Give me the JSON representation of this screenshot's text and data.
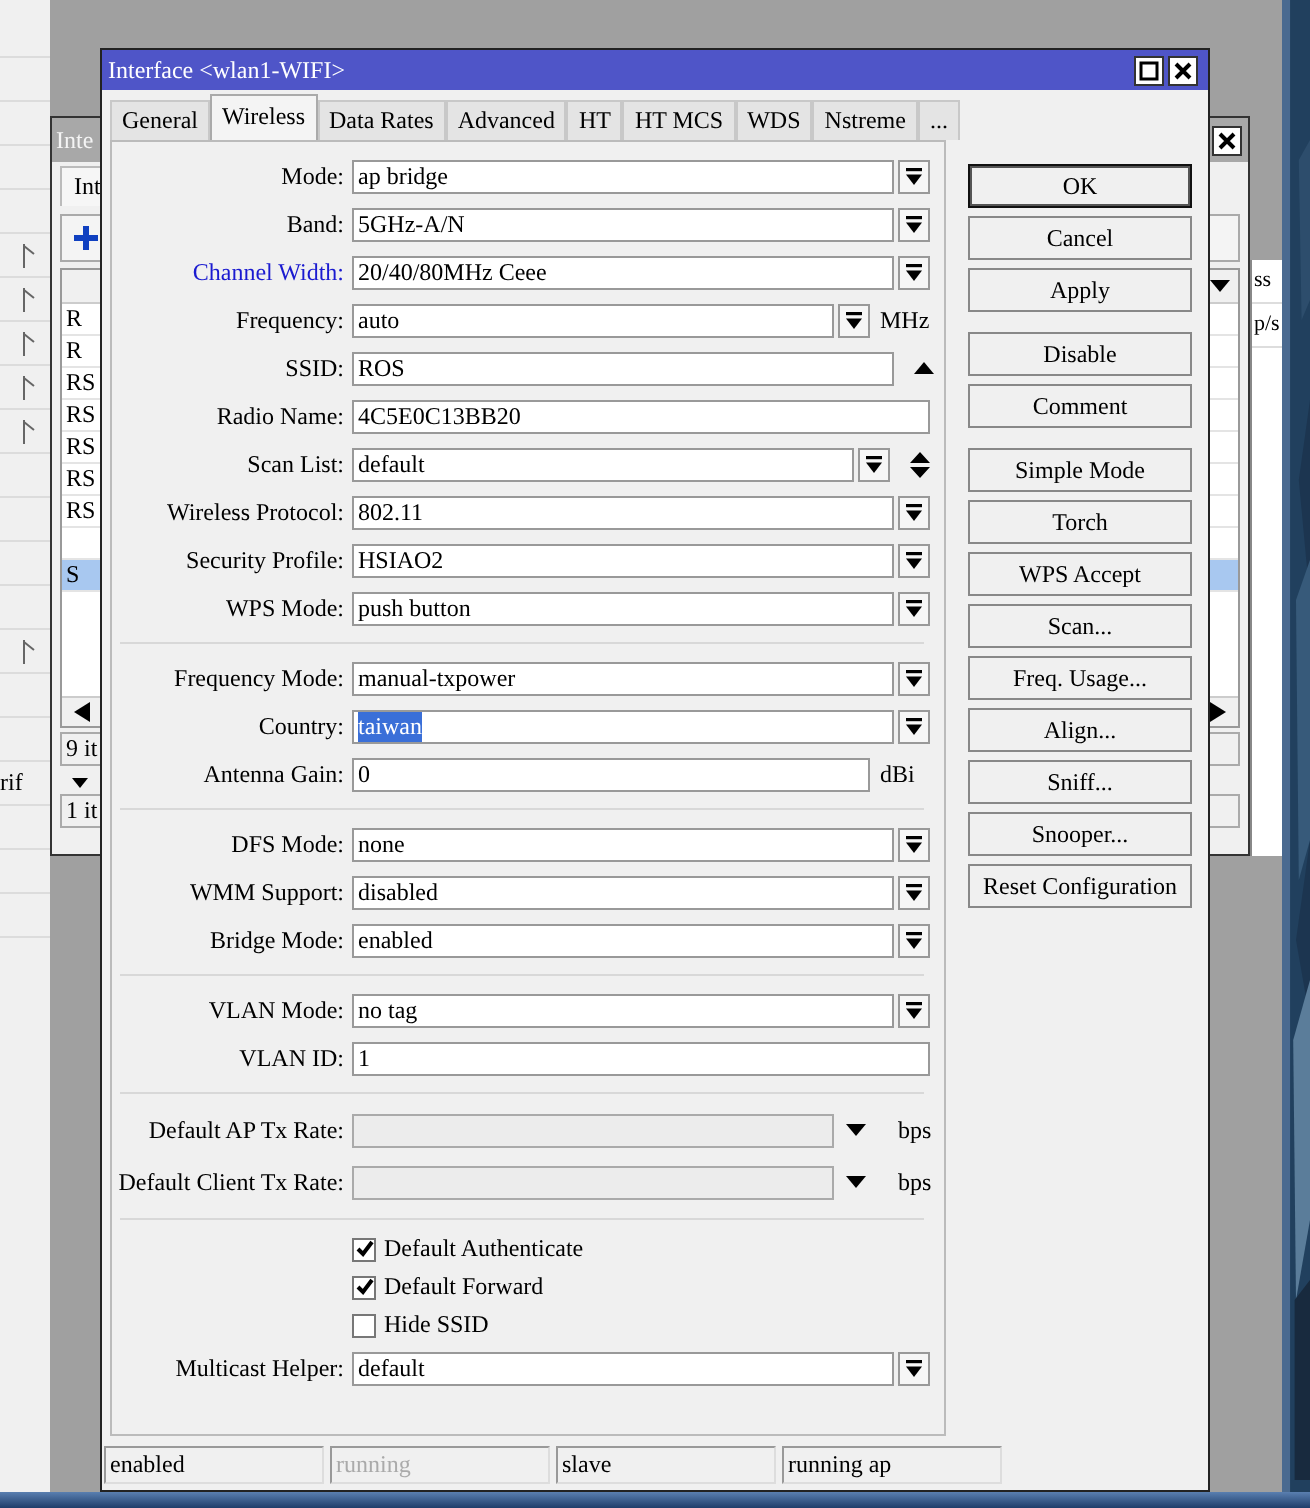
{
  "side_list": {
    "rows": [
      {
        "flagged": false
      },
      {
        "flagged": false
      },
      {
        "flagged": false
      },
      {
        "flagged": false
      },
      {
        "flagged": false
      },
      {
        "flagged": true
      },
      {
        "flagged": true
      },
      {
        "flagged": true
      },
      {
        "flagged": true
      },
      {
        "flagged": true
      },
      {
        "flagged": false
      },
      {
        "flagged": false
      },
      {
        "flagged": false
      },
      {
        "flagged": false
      },
      {
        "flagged": true
      },
      {
        "flagged": false
      },
      {
        "flagged": false
      },
      {
        "flagged": false,
        "text": "rif"
      },
      {
        "flagged": false
      },
      {
        "flagged": false
      },
      {
        "flagged": false
      }
    ]
  },
  "back_window": {
    "title": "Inte",
    "tab": "Int",
    "rows": [
      {
        "flag": "R",
        "selected": false
      },
      {
        "flag": "R",
        "selected": false
      },
      {
        "flag": "RS",
        "selected": false
      },
      {
        "flag": "RS",
        "selected": false
      },
      {
        "flag": "RS",
        "selected": false
      },
      {
        "flag": "RS",
        "selected": false
      },
      {
        "flag": "RS",
        "selected": false
      },
      {
        "selected": false
      },
      {
        "flag": "S",
        "selected": true
      }
    ],
    "counts": [
      "9 it",
      "1 it"
    ]
  },
  "third_window": {
    "headers": [
      "ss",
      "p/s"
    ]
  },
  "dialog": {
    "title": "Interface <wlan1-WIFI>",
    "tabs": [
      {
        "label": "General",
        "selected": false
      },
      {
        "label": "Wireless",
        "selected": true
      },
      {
        "label": "Data Rates",
        "selected": false
      },
      {
        "label": "Advanced",
        "selected": false
      },
      {
        "label": "HT",
        "selected": false
      },
      {
        "label": "HT MCS",
        "selected": false
      },
      {
        "label": "WDS",
        "selected": false
      },
      {
        "label": "Nstreme",
        "selected": false
      },
      {
        "label": "...",
        "selected": false
      }
    ],
    "sections": [
      {
        "fields": [
          {
            "kind": "dropdown",
            "label": "Mode:",
            "value": "ap bridge"
          },
          {
            "kind": "dropdown",
            "label": "Band:",
            "value": "5GHz-A/N"
          },
          {
            "kind": "dropdown",
            "label": "Channel Width:",
            "value": "20/40/80MHz Ceee",
            "emphasized": true
          },
          {
            "kind": "dropdown_unit",
            "label": "Frequency:",
            "value": "auto",
            "unit": "MHz"
          },
          {
            "kind": "collapse",
            "label": "SSID:",
            "value": "ROS"
          },
          {
            "kind": "text",
            "label": "Radio Name:",
            "value": "4C5E0C13BB20"
          },
          {
            "kind": "dropdown_updown",
            "label": "Scan List:",
            "value": "default"
          },
          {
            "kind": "dropdown",
            "label": "Wireless Protocol:",
            "value": "802.11"
          },
          {
            "kind": "dropdown",
            "label": "Security Profile:",
            "value": "HSIAO2"
          },
          {
            "kind": "dropdown",
            "label": "WPS Mode:",
            "value": "push button"
          }
        ]
      },
      {
        "fields": [
          {
            "kind": "dropdown",
            "label": "Frequency Mode:",
            "value": "manual-txpower"
          },
          {
            "kind": "dropdown",
            "label": "Country:",
            "value": "taiwan",
            "value_selected": true
          },
          {
            "kind": "text_unit",
            "label": "Antenna Gain:",
            "value": "0",
            "unit": "dBi"
          }
        ]
      },
      {
        "fields": [
          {
            "kind": "dropdown",
            "label": "DFS Mode:",
            "value": "none"
          },
          {
            "kind": "dropdown",
            "label": "WMM Support:",
            "value": "disabled"
          },
          {
            "kind": "dropdown",
            "label": "Bridge Mode:",
            "value": "enabled"
          }
        ]
      },
      {
        "fields": [
          {
            "kind": "dropdown",
            "label": "VLAN Mode:",
            "value": "no tag"
          },
          {
            "kind": "text",
            "label": "VLAN ID:",
            "value": "1"
          }
        ]
      },
      {
        "fields": [
          {
            "kind": "rate",
            "label": "Default AP Tx Rate:",
            "unit": "bps"
          },
          {
            "kind": "rate",
            "label": "Default Client Tx Rate:",
            "unit": "bps"
          }
        ]
      },
      {
        "fields": [
          {
            "kind": "checkbox",
            "label": "Default Authenticate",
            "checked": true
          },
          {
            "kind": "checkbox",
            "label": "Default Forward",
            "checked": true
          },
          {
            "kind": "checkbox",
            "label": "Hide SSID",
            "checked": false
          },
          {
            "kind": "dropdown",
            "label": "Multicast Helper:",
            "value": "default"
          }
        ]
      }
    ],
    "button_groups": [
      [
        {
          "label": "OK",
          "default": true
        },
        {
          "label": "Cancel",
          "default": false
        },
        {
          "label": "Apply",
          "default": false
        }
      ],
      [
        {
          "label": "Disable",
          "default": false
        },
        {
          "label": "Comment",
          "default": false
        }
      ],
      [
        {
          "label": "Simple Mode",
          "default": false
        },
        {
          "label": "Torch",
          "default": false
        },
        {
          "label": "WPS Accept",
          "default": false
        },
        {
          "label": "Scan...",
          "default": false
        },
        {
          "label": "Freq. Usage...",
          "default": false
        },
        {
          "label": "Align...",
          "default": false
        },
        {
          "label": "Sniff...",
          "default": false
        },
        {
          "label": "Snooper...",
          "default": false
        },
        {
          "label": "Reset Configuration",
          "default": false
        }
      ]
    ],
    "status_bar": [
      {
        "text": "enabled",
        "disabled": false
      },
      {
        "text": "running",
        "disabled": true
      },
      {
        "text": "slave",
        "disabled": false
      },
      {
        "text": "running ap",
        "disabled": false
      }
    ]
  }
}
